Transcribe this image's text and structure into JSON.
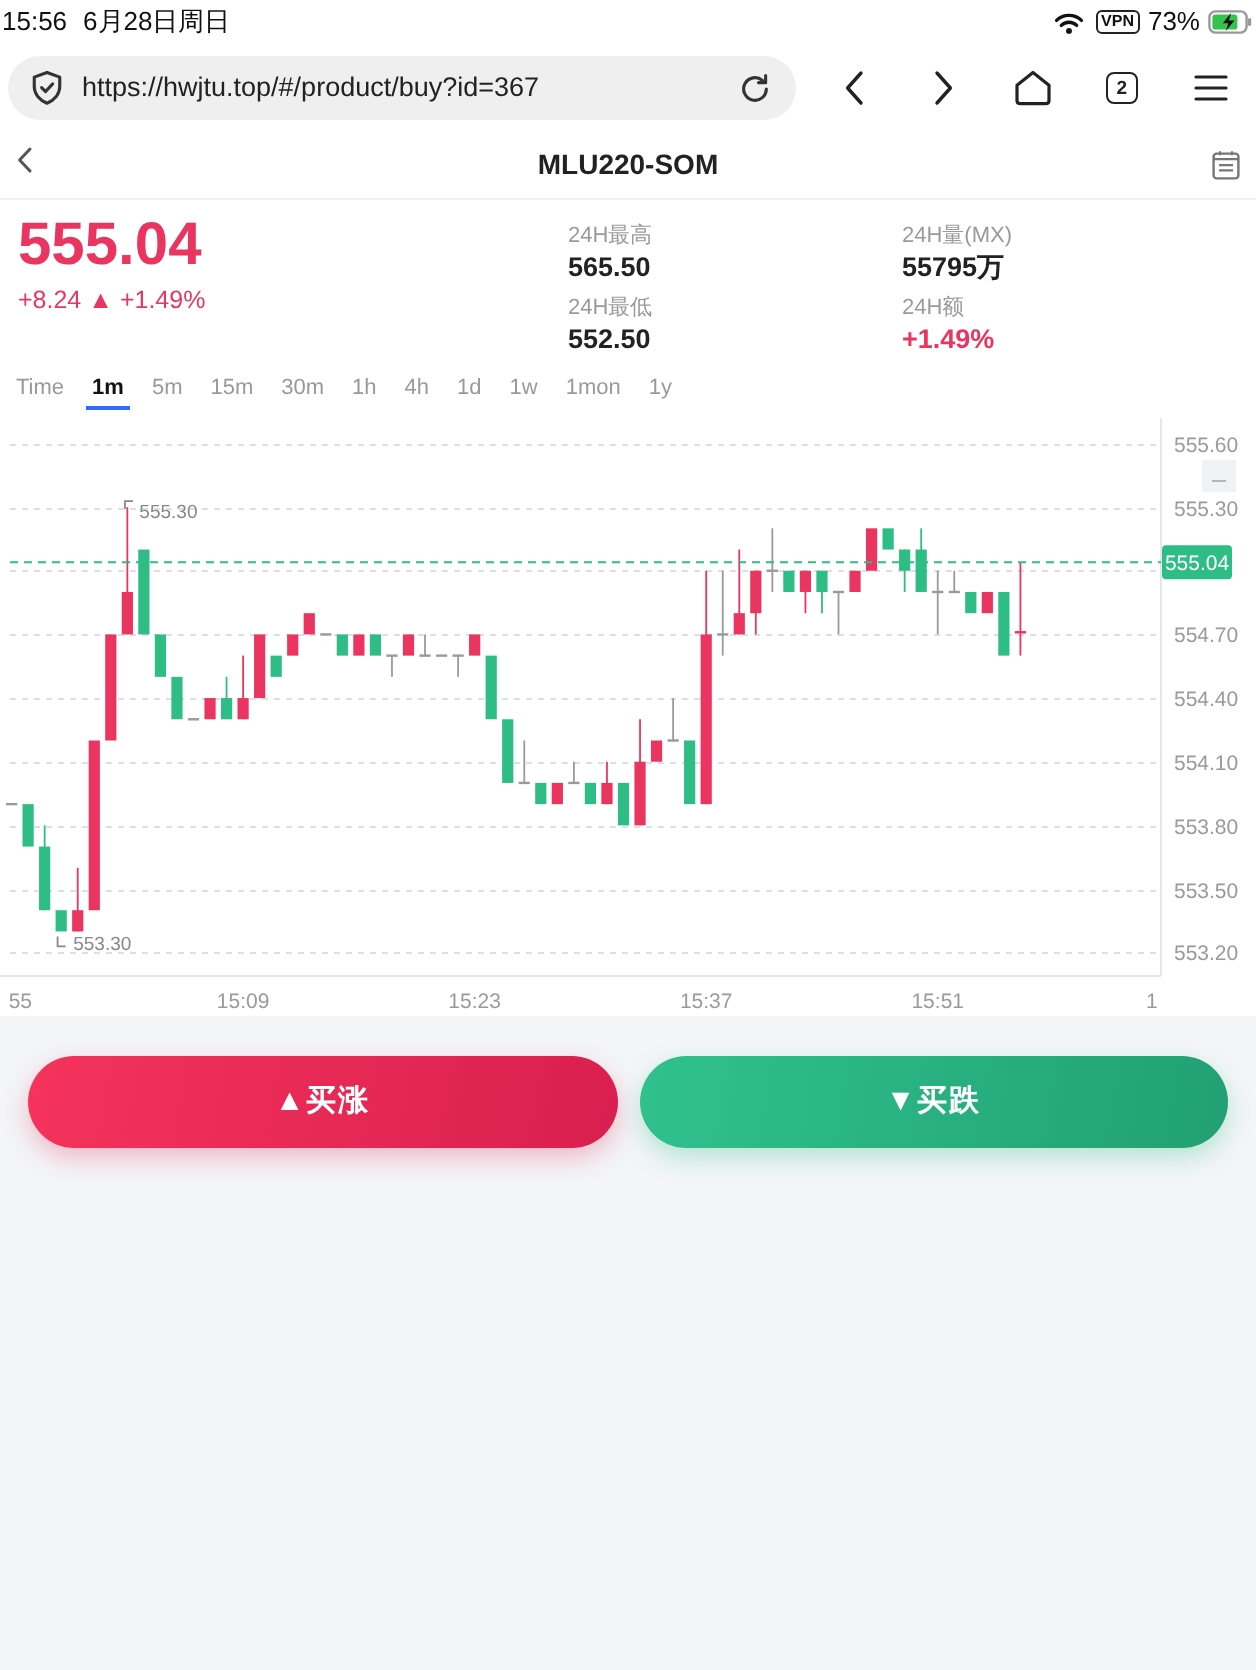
{
  "status_bar": {
    "time": "15:56",
    "date": "6月28日周日",
    "vpn": "VPN",
    "battery": "73%",
    "charging": true
  },
  "browser": {
    "url": "https://hwjtu.top/#/product/buy?id=367",
    "tab_count": "2"
  },
  "header": {
    "title": "MLU220-SOM"
  },
  "quote": {
    "price": "555.04",
    "change": "+8.24 ▲ +1.49%",
    "rising": true,
    "stats": [
      {
        "label": "24H最高",
        "value": "565.50",
        "color": "#222222"
      },
      {
        "label": "24H量(MX)",
        "value": "55795万",
        "color": "#222222"
      },
      {
        "label": "24H最低",
        "value": "552.50",
        "color": "#222222"
      },
      {
        "label": "24H额",
        "value": "+1.49%",
        "color": "#ea3560"
      }
    ]
  },
  "intervals": [
    {
      "label": "Time",
      "selected": false
    },
    {
      "label": "1m",
      "selected": true
    },
    {
      "label": "5m",
      "selected": false
    },
    {
      "label": "15m",
      "selected": false
    },
    {
      "label": "30m",
      "selected": false
    },
    {
      "label": "1h",
      "selected": false
    },
    {
      "label": "4h",
      "selected": false
    },
    {
      "label": "1d",
      "selected": false
    },
    {
      "label": "1w",
      "selected": false
    },
    {
      "label": "1mon",
      "selected": false
    },
    {
      "label": "1y",
      "selected": false
    }
  ],
  "chart": {
    "chart_data": {
      "type": "candlestick",
      "x": [
        895,
        896,
        897,
        898,
        899,
        900,
        901,
        902,
        903,
        904,
        905,
        906,
        907,
        908,
        909,
        910,
        911,
        912,
        913,
        914,
        915,
        916,
        917,
        918,
        919,
        920,
        921,
        922,
        923,
        924,
        925,
        926,
        927,
        928,
        929,
        930,
        931,
        932,
        933,
        934,
        935,
        936,
        937,
        938,
        939,
        940,
        941,
        942,
        943,
        944,
        945,
        946,
        947,
        948,
        949,
        950,
        951,
        952,
        953,
        954,
        955,
        956
      ],
      "ohlc": [
        [
          553.9,
          553.9,
          553.9,
          553.9
        ],
        [
          553.9,
          553.9,
          553.7,
          553.7
        ],
        [
          553.7,
          553.8,
          553.4,
          553.4
        ],
        [
          553.4,
          553.4,
          553.3,
          553.3
        ],
        [
          553.3,
          553.6,
          553.3,
          553.4
        ],
        [
          553.4,
          554.2,
          553.4,
          554.2
        ],
        [
          554.2,
          554.7,
          554.2,
          554.7
        ],
        [
          554.7,
          555.3,
          554.7,
          554.9
        ],
        [
          555.1,
          555.1,
          554.7,
          554.7
        ],
        [
          554.7,
          554.7,
          554.5,
          554.5
        ],
        [
          554.5,
          554.5,
          554.3,
          554.3
        ],
        [
          554.3,
          554.3,
          554.3,
          554.3
        ],
        [
          554.3,
          554.4,
          554.3,
          554.4
        ],
        [
          554.4,
          554.5,
          554.3,
          554.3
        ],
        [
          554.3,
          554.6,
          554.3,
          554.4
        ],
        [
          554.4,
          554.7,
          554.4,
          554.7
        ],
        [
          554.6,
          554.6,
          554.5,
          554.5
        ],
        [
          554.6,
          554.7,
          554.6,
          554.7
        ],
        [
          554.7,
          554.8,
          554.7,
          554.8
        ],
        [
          554.7,
          554.7,
          554.7,
          554.7
        ],
        [
          554.7,
          554.7,
          554.6,
          554.6
        ],
        [
          554.6,
          554.7,
          554.6,
          554.7
        ],
        [
          554.7,
          554.7,
          554.6,
          554.6
        ],
        [
          554.6,
          554.6,
          554.5,
          554.6
        ],
        [
          554.6,
          554.7,
          554.6,
          554.7
        ],
        [
          554.6,
          554.7,
          554.6,
          554.6
        ],
        [
          554.6,
          554.6,
          554.6,
          554.6
        ],
        [
          554.6,
          554.6,
          554.5,
          554.6
        ],
        [
          554.6,
          554.7,
          554.6,
          554.7
        ],
        [
          554.6,
          554.6,
          554.3,
          554.3
        ],
        [
          554.3,
          554.3,
          554.0,
          554.0
        ],
        [
          554.0,
          554.2,
          554.0,
          554.0
        ],
        [
          554.0,
          554.0,
          553.9,
          553.9
        ],
        [
          553.9,
          554.0,
          553.9,
          554.0
        ],
        [
          554.0,
          554.1,
          554.0,
          554.0
        ],
        [
          554.0,
          554.0,
          553.9,
          553.9
        ],
        [
          553.9,
          554.1,
          553.9,
          554.0
        ],
        [
          554.0,
          554.0,
          553.8,
          553.8
        ],
        [
          553.8,
          554.3,
          553.8,
          554.1
        ],
        [
          554.1,
          554.2,
          554.1,
          554.2
        ],
        [
          554.2,
          554.4,
          554.2,
          554.2
        ],
        [
          554.2,
          554.2,
          553.9,
          553.9
        ],
        [
          553.9,
          555.0,
          553.9,
          554.7
        ],
        [
          554.7,
          555.0,
          554.6,
          554.7
        ],
        [
          554.7,
          555.1,
          554.7,
          554.8
        ],
        [
          554.8,
          555.0,
          554.7,
          555.0
        ],
        [
          555.0,
          555.2,
          554.9,
          555.0
        ],
        [
          555.0,
          555.0,
          554.9,
          554.9
        ],
        [
          554.9,
          555.0,
          554.8,
          555.0
        ],
        [
          555.0,
          555.0,
          554.8,
          554.9
        ],
        [
          554.9,
          554.9,
          554.7,
          554.9
        ],
        [
          554.9,
          555.0,
          554.9,
          555.0
        ],
        [
          555.0,
          555.2,
          555.0,
          555.2
        ],
        [
          555.2,
          555.2,
          555.1,
          555.1
        ],
        [
          555.1,
          555.1,
          554.9,
          555.0
        ],
        [
          555.1,
          555.2,
          554.9,
          554.9
        ],
        [
          554.9,
          555.0,
          554.7,
          554.9
        ],
        [
          554.9,
          555.0,
          554.9,
          554.9
        ],
        [
          554.9,
          554.9,
          554.8,
          554.8
        ],
        [
          554.8,
          554.9,
          554.8,
          554.9
        ],
        [
          554.9,
          554.9,
          554.6,
          554.6
        ],
        [
          554.7,
          555.04,
          554.6,
          554.71
        ]
      ],
      "xlim": [
        894.3,
        964.5
      ],
      "ylim": [
        553.09,
        555.72
      ],
      "yticks": [
        {
          "value": 555.6,
          "label": "555.60"
        },
        {
          "value": 555.3,
          "label": "555.30"
        },
        {
          "value": 554.7,
          "label": "554.70"
        },
        {
          "value": 554.4,
          "label": "554.40"
        },
        {
          "value": 554.1,
          "label": "554.10"
        },
        {
          "value": 553.8,
          "label": "553.80"
        },
        {
          "value": 553.5,
          "label": "553.50"
        },
        {
          "value": 553.2,
          "label": "553.20"
        }
      ],
      "xticks": [
        {
          "value": 909,
          "label": "15:09"
        },
        {
          "value": 923,
          "label": "15:23"
        },
        {
          "value": 937,
          "label": "15:37"
        },
        {
          "value": 951,
          "label": "15:51"
        }
      ],
      "grid": true,
      "ref_lines": [
        {
          "axis": "y",
          "value": 555.04,
          "label": "555.04",
          "color": "#2ebd85"
        }
      ]
    },
    "edge_x_labels": [
      "55",
      "1"
    ],
    "high_label": "555.30",
    "low_label": "553.30"
  },
  "actions": [
    {
      "label": "▲买涨",
      "kind": "buy_up"
    },
    {
      "label": "▼买跌",
      "kind": "buy_down"
    }
  ]
}
